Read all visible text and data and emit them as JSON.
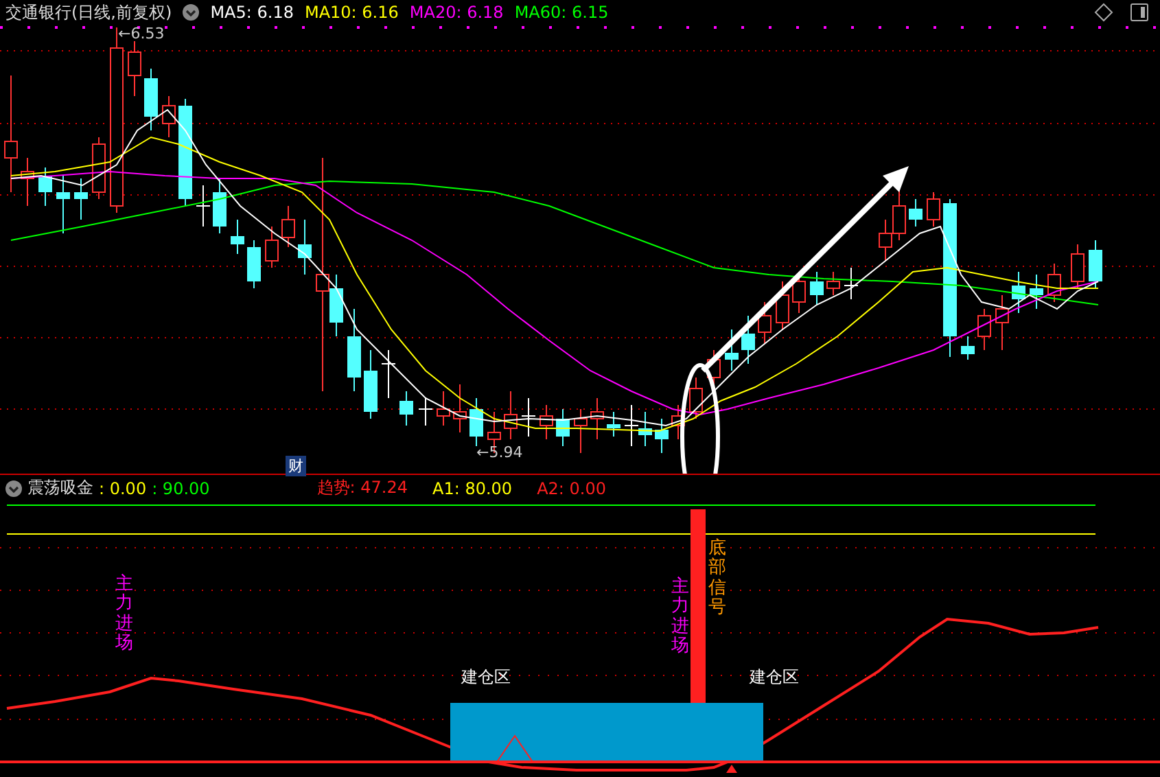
{
  "header": {
    "title": "交通银行(日线,前复权)",
    "ma_legend": [
      {
        "label": "MA5: 6.18",
        "color": "#ffffff"
      },
      {
        "label": "MA10: 6.16",
        "color": "#ffff00"
      },
      {
        "label": "MA20: 6.18",
        "color": "#ff00ff"
      },
      {
        "label": "MA60: 6.15",
        "color": "#00ff00"
      }
    ]
  },
  "price_chart": {
    "high_label": "←6.53",
    "low_label": "←5.94",
    "badge": "财"
  },
  "indicator": {
    "name": "震荡吸金",
    "values": [
      {
        "text": ": 0.00",
        "color": "#ffff00"
      },
      {
        "text": ": 90.00",
        "color": "#00ff00"
      }
    ],
    "legend": [
      {
        "label": "趋势",
        "value": ": 47.24",
        "color": "#ff2020"
      },
      {
        "label": "A1",
        "value": ": 80.00",
        "color": "#ffff00"
      },
      {
        "label": "A2",
        "value": ": 0.00",
        "color": "#ff2020"
      }
    ],
    "vertical_labels": [
      {
        "text": "主力进场",
        "color": "#ff00ff"
      },
      {
        "text": "主力进场",
        "color": "#ff00ff"
      },
      {
        "text": "底部信号",
        "color": "#ff9900"
      }
    ],
    "zone_labels": [
      "建仓区",
      "建仓区"
    ]
  }
}
